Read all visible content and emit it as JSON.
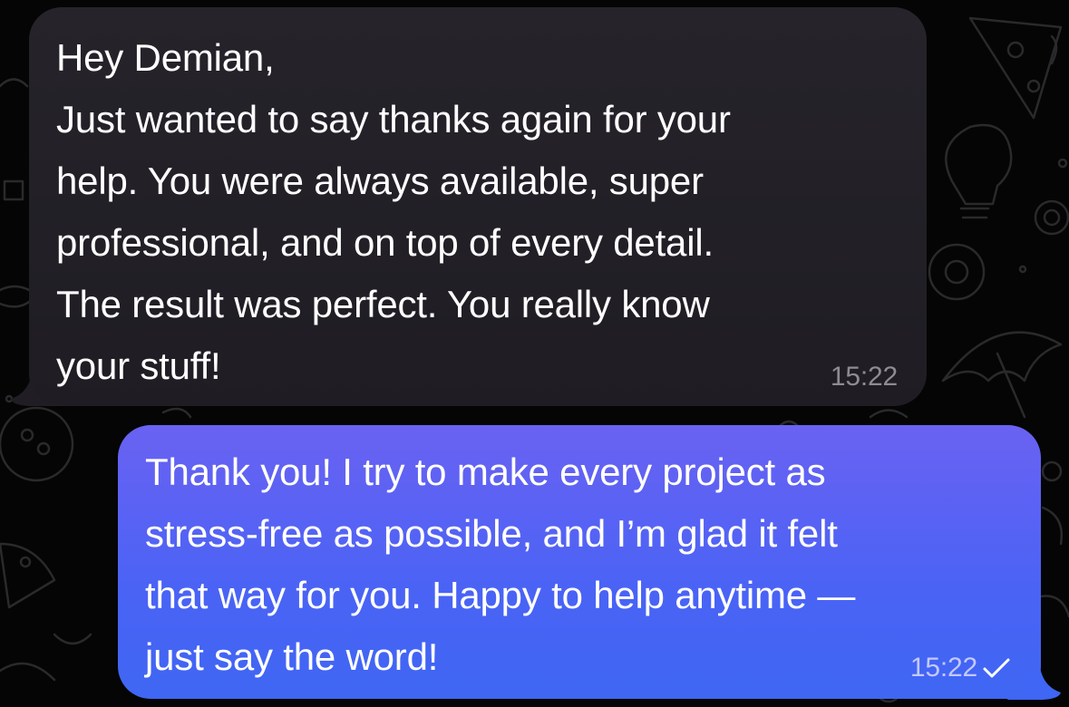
{
  "messages": [
    {
      "direction": "incoming",
      "text": "Hey Demian,\nJust wanted to say thanks again for your\nhelp. You were always available, super\nprofessional, and on top of every detail.\nThe result was perfect. You really know\nyour stuff!",
      "time": "15:22"
    },
    {
      "direction": "outgoing",
      "text": "Thank you! I try to make every project as\nstress-free as possible, and I’m glad it felt\nthat way for you. Happy to help anytime —\njust say the word!",
      "time": "15:22",
      "status_icon": "single-check-icon"
    }
  ],
  "colors": {
    "background": "#050505",
    "incoming_bubble": "#24212a",
    "outgoing_bubble": "#4a63f5",
    "incoming_time": "#8e8b94",
    "outgoing_time": "#c4c8ff"
  }
}
